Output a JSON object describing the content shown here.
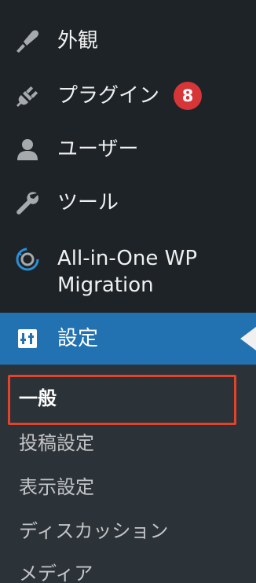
{
  "menu": {
    "appearance": {
      "label": "外観",
      "icon": "paintbrush-icon"
    },
    "plugins": {
      "label": "プラグイン",
      "icon": "plugin-icon",
      "badge": "8"
    },
    "users": {
      "label": "ユーザー",
      "icon": "user-icon"
    },
    "tools": {
      "label": "ツール",
      "icon": "wrench-icon"
    },
    "migration": {
      "label": "All-in-One WP Migration",
      "icon": "migration-icon"
    },
    "settings": {
      "label": "設定",
      "icon": "settings-sliders-icon"
    }
  },
  "submenu": {
    "general": "一般",
    "writing": "投稿設定",
    "reading": "表示設定",
    "discussion": "ディスカッション",
    "media": "メディア"
  },
  "colors": {
    "sidebar_bg": "#1d2327",
    "submenu_bg": "#2c3338",
    "current_bg": "#2271b1",
    "badge_bg": "#d63638",
    "highlight_border": "#e2432a"
  }
}
